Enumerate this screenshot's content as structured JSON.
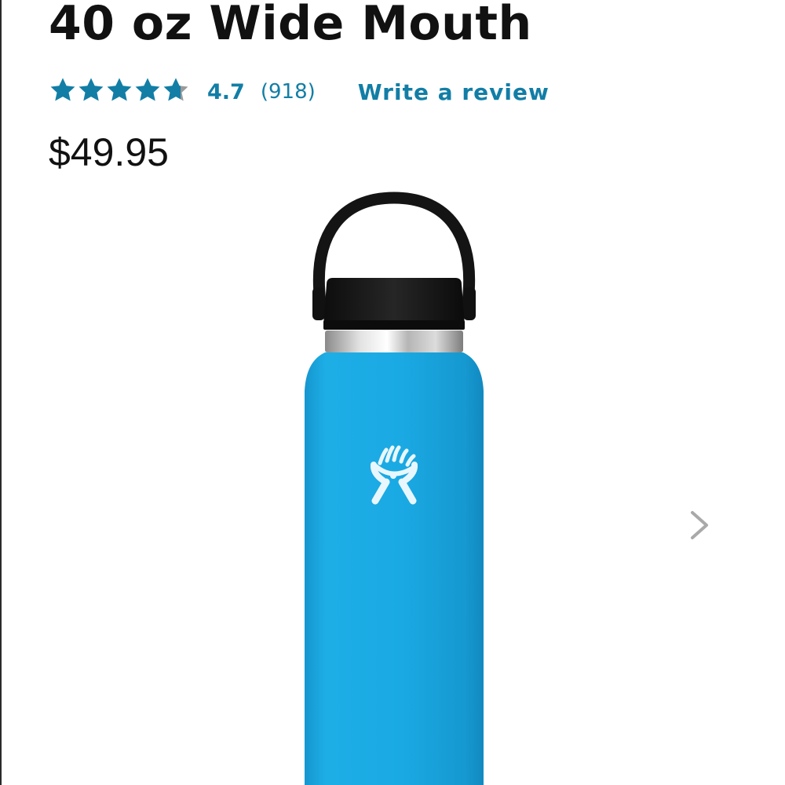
{
  "product": {
    "title": "40 oz Wide Mouth",
    "rating_value": "4.7",
    "review_count": "(918)",
    "write_review_label": "Write a review",
    "price": "$49.95",
    "rating_stars": 4.7,
    "rating_max": 5
  },
  "colors": {
    "accent": "#127ea6",
    "bottle": "#1aa8e2",
    "cap": "#151515"
  },
  "icons": {
    "star": "star-icon",
    "next": "chevron-right-icon",
    "logo": "hand-logo-icon"
  }
}
